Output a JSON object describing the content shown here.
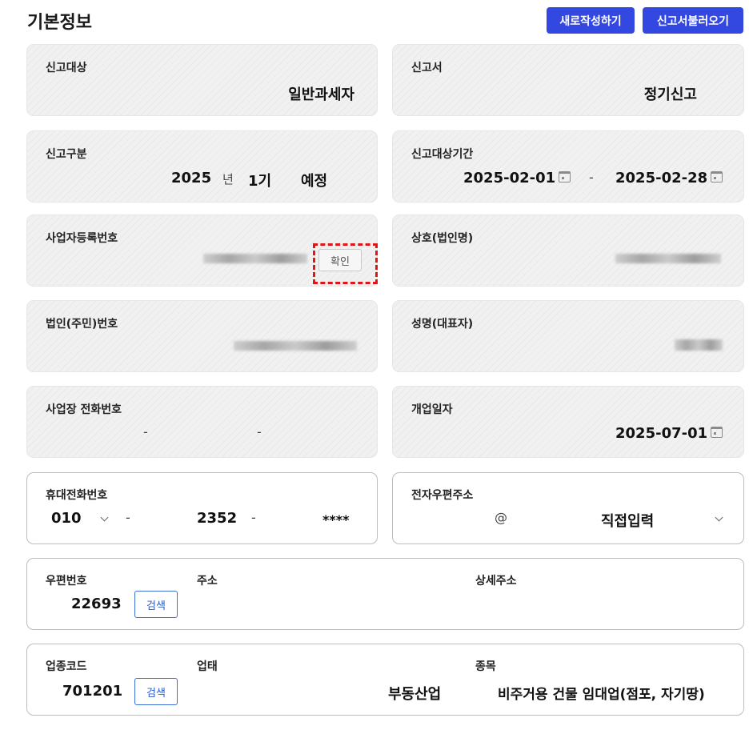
{
  "page_title": "기본정보",
  "buttons": {
    "new": "새로작성하기",
    "load": "신고서불러오기"
  },
  "report_target": {
    "label": "신고대상",
    "value": "일반과세자"
  },
  "report_form": {
    "label": "신고서",
    "value": "정기신고"
  },
  "report_type": {
    "label": "신고구분",
    "year": "2025",
    "year_unit": "년",
    "period": "1기",
    "kind": "예정"
  },
  "report_period": {
    "label": "신고대상기간",
    "start": "2025-02-01",
    "separator": "-",
    "end": "2025-02-28"
  },
  "business_reg": {
    "label": "사업자등록번호",
    "confirm": "확인"
  },
  "company_name": {
    "label": "상호(법인명)"
  },
  "corp_id": {
    "label": "법인(주민)번호"
  },
  "rep_name": {
    "label": "성명(대표자)"
  },
  "biz_phone": {
    "label": "사업장 전화번호",
    "sep1": "-",
    "sep2": "-"
  },
  "open_date": {
    "label": "개업일자",
    "value": "2025-07-01"
  },
  "mobile": {
    "label": "휴대전화번호",
    "prefix": "010",
    "sep1": "-",
    "middle": "2352",
    "sep2": "-",
    "last": "****"
  },
  "email": {
    "label": "전자우편주소",
    "at": "@",
    "domain_select": "직접입력"
  },
  "address": {
    "zip_label": "우편번호",
    "zip": "22693",
    "search": "검색",
    "addr_label": "주소",
    "detail_label": "상세주소"
  },
  "industry": {
    "code_label": "업종코드",
    "code": "701201",
    "search": "검색",
    "type_label": "업태",
    "type": "부동산업",
    "item_label": "종목",
    "item": "비주거용 건물 임대업(점포, 자기땅)"
  }
}
